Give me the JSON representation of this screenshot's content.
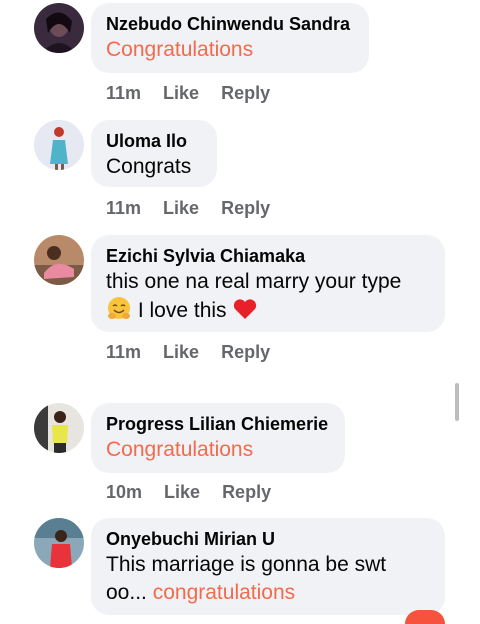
{
  "comments": [
    {
      "author": "Nzebudo Chinwendu Sandra",
      "text": "Congratulations",
      "time": "11m",
      "like": "Like",
      "reply": "Reply"
    },
    {
      "author": "Uloma Ilo",
      "text": "Congrats",
      "time": "11m",
      "like": "Like",
      "reply": "Reply"
    },
    {
      "author": "Ezichi Sylvia Chiamaka",
      "text_line1": "this one na real marry your type",
      "text_line2": "I love this",
      "emoji1": "hugging-face-emoji",
      "emoji2": "red-heart-emoji",
      "time": "11m",
      "like": "Like",
      "reply": "Reply"
    },
    {
      "author": "Progress Lilian Chiemerie",
      "text": "Congratulations",
      "time": "10m",
      "like": "Like",
      "reply": "Reply"
    },
    {
      "author": "Onyebuchi Mirian U",
      "text_line1": "This marriage is gonna be swt",
      "text_line2_prefix": "oo...",
      "text_line2_highlight": "congratulations"
    }
  ],
  "colors": {
    "bubble": "#f0f2f5",
    "highlight": "#f36a4c",
    "meta": "#65676b"
  }
}
